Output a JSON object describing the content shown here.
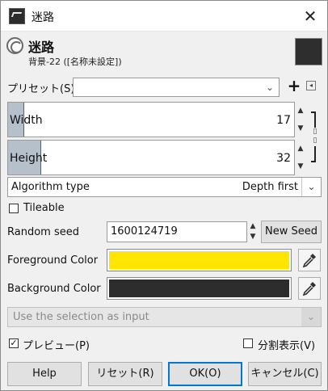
{
  "window": {
    "title": "迷路",
    "close_glyph": "✕"
  },
  "header": {
    "title": "迷路",
    "subtitle": "背景-22 ([名称未設定])",
    "preview_color": "#2e2e2e"
  },
  "preset": {
    "label": "プリセット(S):",
    "value": "",
    "add_glyph": "+",
    "menu_glyph": "◂"
  },
  "width": {
    "label": "Width",
    "value": "17"
  },
  "height": {
    "label": "Height",
    "value": "32"
  },
  "spin_glyphs": {
    "up": "▲",
    "down": "▼"
  },
  "algorithm": {
    "label": "Algorithm type",
    "value": "Depth first",
    "arrow": "⌄"
  },
  "tileable": {
    "label": "Tileable",
    "checked": false
  },
  "seed": {
    "label": "Random seed",
    "value": "1600124719",
    "new_seed_label": "New Seed"
  },
  "foreground": {
    "label": "Foreground Color",
    "color": "#ffe600"
  },
  "background": {
    "label": "Background Color",
    "color": "#2d2d2d"
  },
  "selection_input": {
    "label": "Use the selection as input",
    "arrow": "⌄"
  },
  "preview": {
    "label": "プレビュー(P)",
    "checked": true,
    "check_glyph": "✓"
  },
  "split_view": {
    "label": "分割表示(V)",
    "checked": false
  },
  "buttons": {
    "help": "Help",
    "reset": "リセット(R)",
    "ok": "OK(O)",
    "cancel": "キャンセル(C)"
  }
}
